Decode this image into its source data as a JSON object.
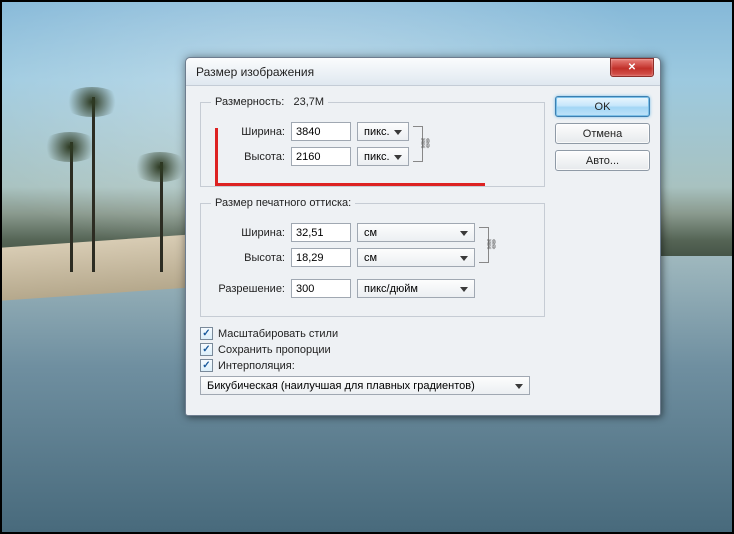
{
  "dialog": {
    "title": "Размер изображения",
    "close_glyph": "✕"
  },
  "buttons": {
    "ok": "OK",
    "cancel": "Отмена",
    "auto": "Авто..."
  },
  "pixel": {
    "legend_label": "Размерность:",
    "legend_value": "23,7M",
    "width_label": "Ширина:",
    "width_value": "3840",
    "height_label": "Высота:",
    "height_value": "2160",
    "unit": "пикс."
  },
  "print": {
    "legend": "Размер печатного оттиска:",
    "width_label": "Ширина:",
    "width_value": "32,51",
    "height_label": "Высота:",
    "height_value": "18,29",
    "unit": "см",
    "res_label": "Разрешение:",
    "res_value": "300",
    "res_unit": "пикс/дюйм"
  },
  "options": {
    "scale_styles": "Масштабировать стили",
    "constrain": "Сохранить пропорции",
    "resample": "Интерполяция:"
  },
  "interp": {
    "selected": "Бикубическая (наилучшая для плавных градиентов)"
  },
  "link_glyph": "⛓"
}
